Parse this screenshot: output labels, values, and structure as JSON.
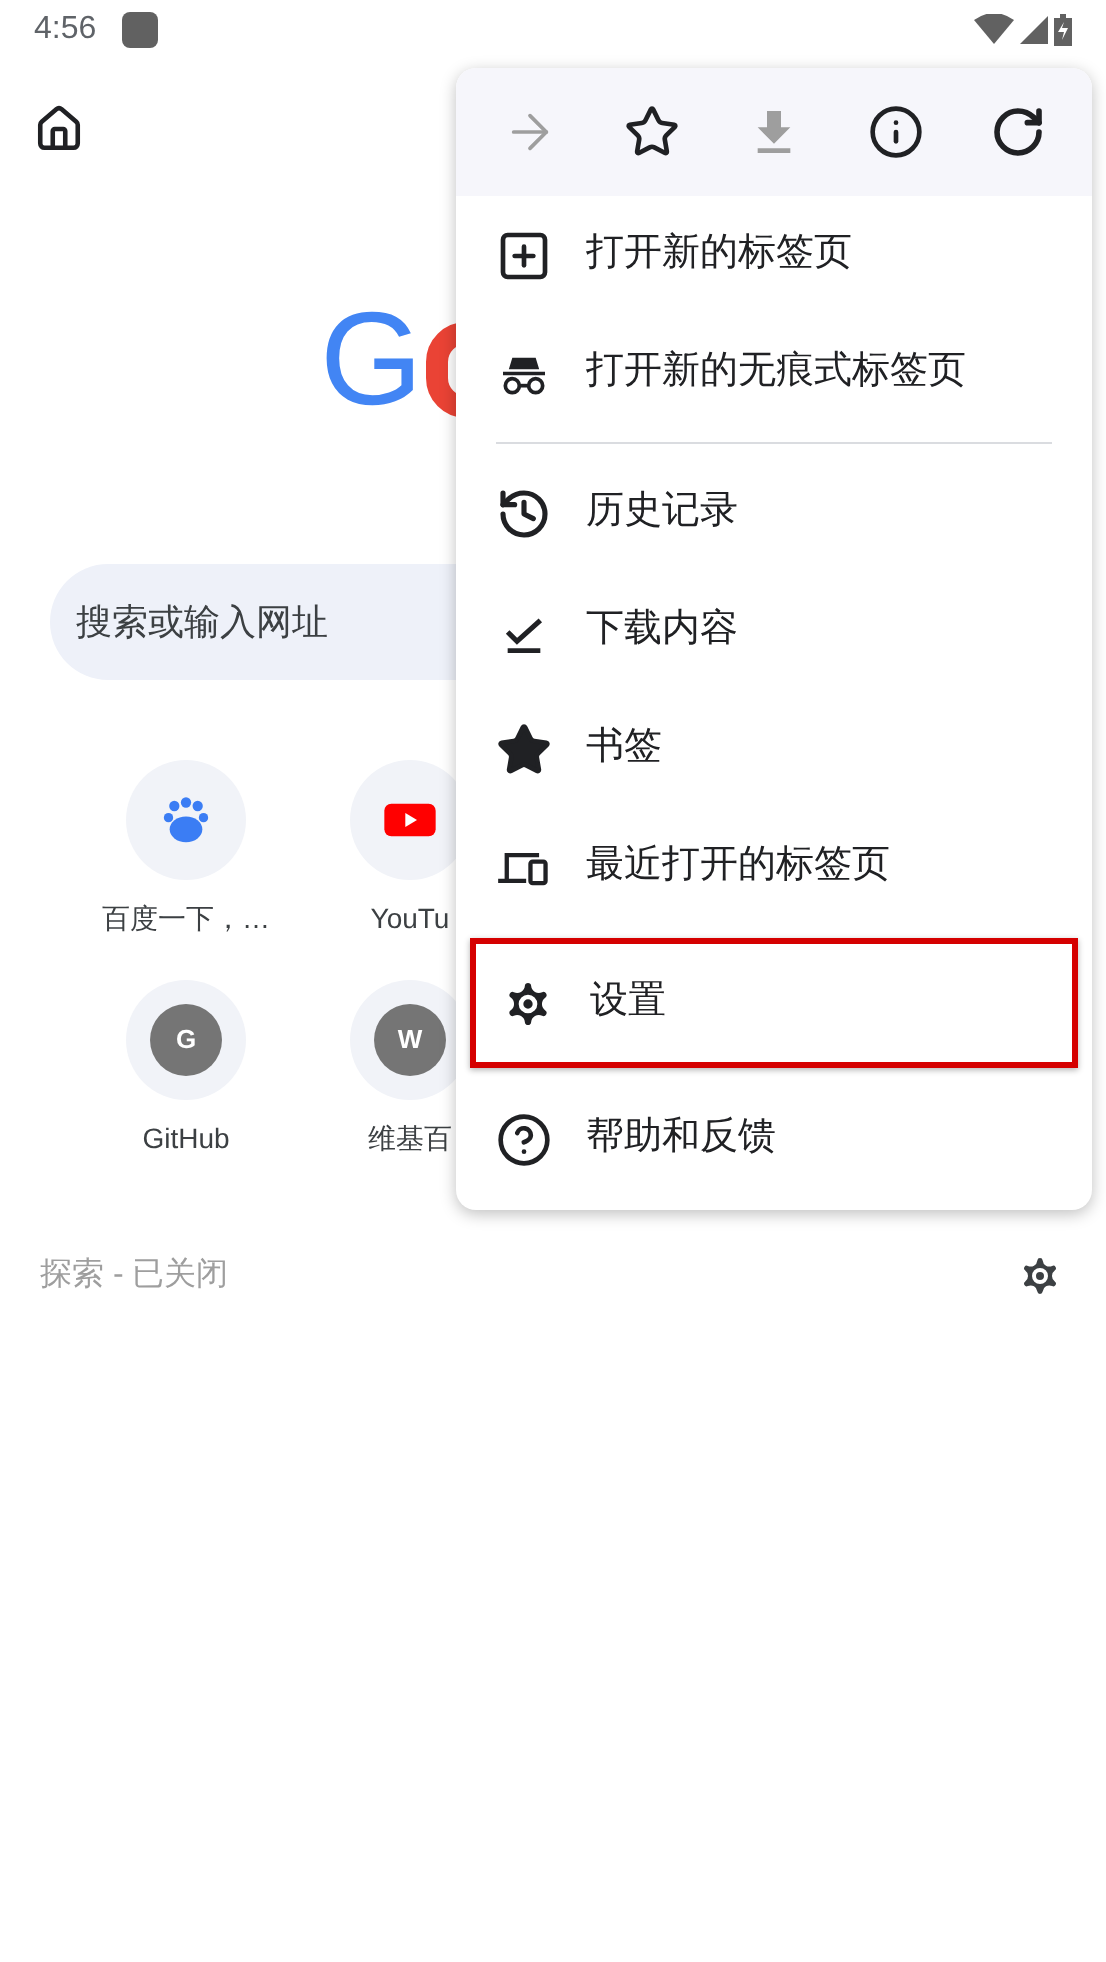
{
  "status_bar": {
    "time": "4:56"
  },
  "logo": {
    "text": "G"
  },
  "search": {
    "placeholder": "搜索或输入网址"
  },
  "shortcuts": [
    {
      "kind": "baidu",
      "label": "百度一下，…"
    },
    {
      "kind": "youtube",
      "label": "YouTu"
    },
    {
      "kind": "letter",
      "letter": "G",
      "label": "GitHub"
    },
    {
      "kind": "letter",
      "letter": "W",
      "label": "维基百"
    }
  ],
  "explore": {
    "label": "探索 - 已关闭"
  },
  "menu": {
    "toolbar": [
      {
        "disabled": true
      },
      {
        "disabled": false
      },
      {
        "disabled": true
      },
      {
        "disabled": false
      },
      {
        "disabled": false
      }
    ],
    "items": [
      {
        "label": "打开新的标签页",
        "highlighted": false,
        "divider_after": false
      },
      {
        "label": "打开新的无痕式标签页",
        "highlighted": false,
        "divider_after": true
      },
      {
        "label": "历史记录",
        "highlighted": false,
        "divider_after": false
      },
      {
        "label": "下载内容",
        "highlighted": false,
        "divider_after": false
      },
      {
        "label": "书签",
        "highlighted": false,
        "divider_after": false
      },
      {
        "label": "最近打开的标签页",
        "highlighted": false,
        "divider_after": false
      },
      {
        "label": "设置",
        "highlighted": true,
        "divider_after": false
      },
      {
        "label": "帮助和反馈",
        "highlighted": false,
        "divider_after": false
      }
    ]
  }
}
